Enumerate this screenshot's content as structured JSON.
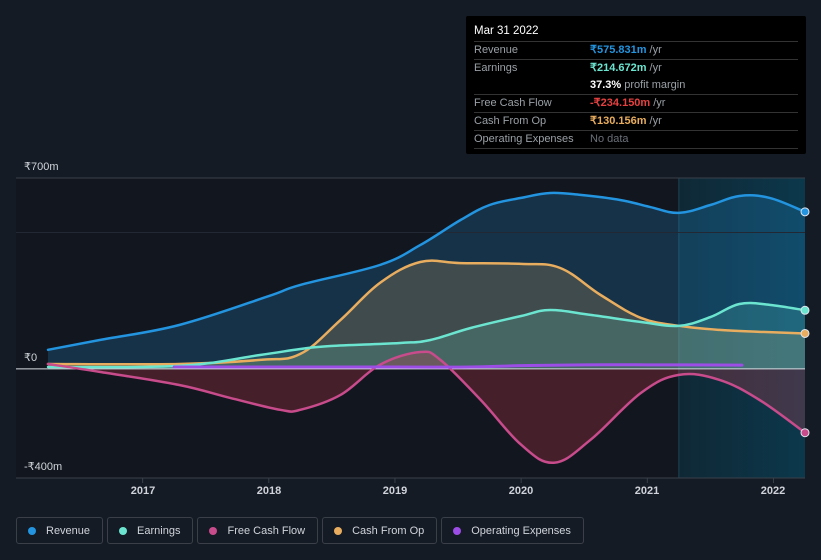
{
  "tooltip": {
    "date": "Mar 31 2022",
    "rows": [
      {
        "label": "Revenue",
        "value": "₹575.831m",
        "unit": "/yr",
        "color": "#2394df"
      },
      {
        "label": "Earnings",
        "value": "₹214.672m",
        "unit": "/yr",
        "color": "#6ce5d0"
      },
      {
        "label": "",
        "value": "37.3%",
        "unit": "profit margin",
        "color": "#ffffff"
      },
      {
        "label": "Free Cash Flow",
        "value": "-₹234.150m",
        "unit": "/yr",
        "color": "#e64141"
      },
      {
        "label": "Cash From Op",
        "value": "₹130.156m",
        "unit": "/yr",
        "color": "#e8ad5f"
      },
      {
        "label": "Operating Expenses",
        "value": "No data",
        "unit": "",
        "color": "#6b7079"
      }
    ]
  },
  "chart_data": {
    "type": "area",
    "title": "",
    "xlabel": "",
    "ylabel": "",
    "currency": "₹",
    "ylim": [
      -400,
      700
    ],
    "xlim": [
      2016.25,
      2022.25
    ],
    "y_tick_labels": [
      {
        "value": 700,
        "label": "₹700m"
      },
      {
        "value": 0,
        "label": "₹0"
      },
      {
        "value": -400,
        "label": "-₹400m"
      }
    ],
    "x_tick_labels": [
      "2017",
      "2018",
      "2019",
      "2020",
      "2021",
      "2022"
    ],
    "x_ticks": [
      2017,
      2018,
      2019,
      2020,
      2021,
      2022
    ],
    "highlight_range": [
      2021.25,
      2022.25
    ],
    "grid": true,
    "legend_position": "bottom-left",
    "series": [
      {
        "name": "Revenue",
        "color": "#2394df",
        "x": [
          2016.25,
          2016.66,
          2017.29,
          2018.0,
          2018.25,
          2018.88,
          2019.2,
          2019.52,
          2019.75,
          2020.0,
          2020.23,
          2020.47,
          2020.79,
          2021.02,
          2021.25,
          2021.5,
          2021.73,
          2021.97,
          2022.25
        ],
        "values": [
          70,
          106,
          161,
          267,
          308,
          381,
          454,
          546,
          601,
          627,
          645,
          638,
          619,
          594,
          572,
          601,
          634,
          627,
          576
        ]
      },
      {
        "name": "Earnings",
        "color": "#6ce5d0",
        "x": [
          2016.25,
          2017.29,
          2017.93,
          2018.25,
          2018.49,
          2019.04,
          2019.28,
          2019.6,
          2020.0,
          2020.23,
          2020.55,
          2020.95,
          2021.25,
          2021.5,
          2021.73,
          2021.97,
          2022.25
        ],
        "values": [
          7,
          11,
          51,
          73,
          84,
          95,
          106,
          150,
          194,
          216,
          198,
          172,
          158,
          190,
          238,
          235,
          215
        ]
      },
      {
        "name": "Free Cash Flow",
        "color": "#c84b8c",
        "x": [
          2016.25,
          2016.66,
          2017.29,
          2017.69,
          2018.09,
          2018.25,
          2018.57,
          2018.88,
          2019.2,
          2019.36,
          2019.68,
          2020.0,
          2020.26,
          2020.55,
          2020.95,
          2021.25,
          2021.57,
          2021.89,
          2022.25
        ],
        "values": [
          18,
          -11,
          -59,
          -106,
          -150,
          -150,
          -95,
          15,
          62,
          33,
          -114,
          -278,
          -344,
          -260,
          -88,
          -22,
          -40,
          -114,
          -234
        ]
      },
      {
        "name": "Cash From Op",
        "color": "#e8ad5f",
        "x": [
          2016.25,
          2017.29,
          2017.93,
          2018.25,
          2018.57,
          2018.88,
          2019.2,
          2019.52,
          2020.0,
          2020.31,
          2020.63,
          2020.95,
          2021.25,
          2021.57,
          2021.89,
          2022.25
        ],
        "values": [
          18,
          18,
          33,
          55,
          180,
          315,
          392,
          388,
          385,
          370,
          271,
          187,
          158,
          143,
          136,
          130
        ]
      },
      {
        "name": "Operating Expenses",
        "color": "#9b4de6",
        "x": [
          2017.25,
          2018.0,
          2019.0,
          2019.6,
          2020.0,
          2020.5,
          2021.0,
          2021.75
        ],
        "values": [
          7,
          7,
          7,
          7,
          12,
          15,
          15,
          14
        ]
      }
    ]
  },
  "legend": [
    {
      "label": "Revenue",
      "color": "#2394df"
    },
    {
      "label": "Earnings",
      "color": "#6ce5d0"
    },
    {
      "label": "Free Cash Flow",
      "color": "#c84b8c"
    },
    {
      "label": "Cash From Op",
      "color": "#e8ad5f"
    },
    {
      "label": "Operating Expenses",
      "color": "#9b4de6"
    }
  ]
}
